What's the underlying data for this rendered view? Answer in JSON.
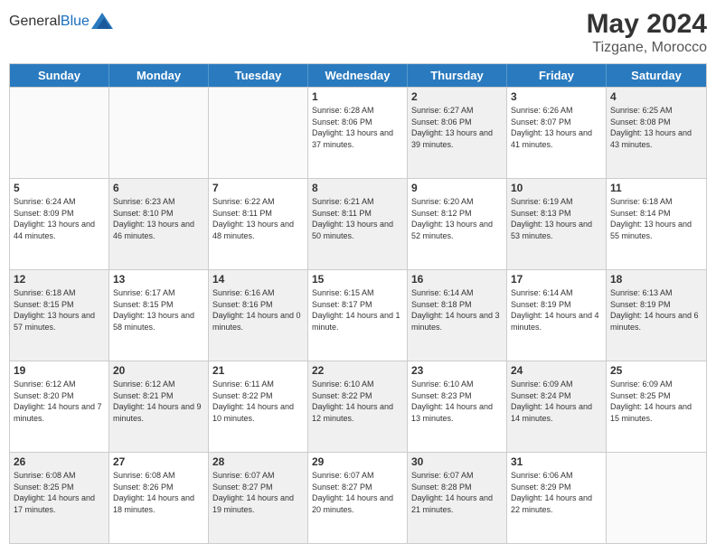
{
  "header": {
    "logo_general": "General",
    "logo_blue": "Blue",
    "month_year": "May 2024",
    "location": "Tizgane, Morocco"
  },
  "days_of_week": [
    "Sunday",
    "Monday",
    "Tuesday",
    "Wednesday",
    "Thursday",
    "Friday",
    "Saturday"
  ],
  "weeks": [
    [
      {
        "day": "",
        "info": "",
        "shaded": false,
        "empty": true
      },
      {
        "day": "",
        "info": "",
        "shaded": false,
        "empty": true
      },
      {
        "day": "",
        "info": "",
        "shaded": false,
        "empty": true
      },
      {
        "day": "1",
        "info": "Sunrise: 6:28 AM\nSunset: 8:06 PM\nDaylight: 13 hours and 37 minutes.",
        "shaded": false,
        "empty": false
      },
      {
        "day": "2",
        "info": "Sunrise: 6:27 AM\nSunset: 8:06 PM\nDaylight: 13 hours and 39 minutes.",
        "shaded": true,
        "empty": false
      },
      {
        "day": "3",
        "info": "Sunrise: 6:26 AM\nSunset: 8:07 PM\nDaylight: 13 hours and 41 minutes.",
        "shaded": false,
        "empty": false
      },
      {
        "day": "4",
        "info": "Sunrise: 6:25 AM\nSunset: 8:08 PM\nDaylight: 13 hours and 43 minutes.",
        "shaded": true,
        "empty": false
      }
    ],
    [
      {
        "day": "5",
        "info": "Sunrise: 6:24 AM\nSunset: 8:09 PM\nDaylight: 13 hours and 44 minutes.",
        "shaded": false,
        "empty": false
      },
      {
        "day": "6",
        "info": "Sunrise: 6:23 AM\nSunset: 8:10 PM\nDaylight: 13 hours and 46 minutes.",
        "shaded": true,
        "empty": false
      },
      {
        "day": "7",
        "info": "Sunrise: 6:22 AM\nSunset: 8:11 PM\nDaylight: 13 hours and 48 minutes.",
        "shaded": false,
        "empty": false
      },
      {
        "day": "8",
        "info": "Sunrise: 6:21 AM\nSunset: 8:11 PM\nDaylight: 13 hours and 50 minutes.",
        "shaded": true,
        "empty": false
      },
      {
        "day": "9",
        "info": "Sunrise: 6:20 AM\nSunset: 8:12 PM\nDaylight: 13 hours and 52 minutes.",
        "shaded": false,
        "empty": false
      },
      {
        "day": "10",
        "info": "Sunrise: 6:19 AM\nSunset: 8:13 PM\nDaylight: 13 hours and 53 minutes.",
        "shaded": true,
        "empty": false
      },
      {
        "day": "11",
        "info": "Sunrise: 6:18 AM\nSunset: 8:14 PM\nDaylight: 13 hours and 55 minutes.",
        "shaded": false,
        "empty": false
      }
    ],
    [
      {
        "day": "12",
        "info": "Sunrise: 6:18 AM\nSunset: 8:15 PM\nDaylight: 13 hours and 57 minutes.",
        "shaded": true,
        "empty": false
      },
      {
        "day": "13",
        "info": "Sunrise: 6:17 AM\nSunset: 8:15 PM\nDaylight: 13 hours and 58 minutes.",
        "shaded": false,
        "empty": false
      },
      {
        "day": "14",
        "info": "Sunrise: 6:16 AM\nSunset: 8:16 PM\nDaylight: 14 hours and 0 minutes.",
        "shaded": true,
        "empty": false
      },
      {
        "day": "15",
        "info": "Sunrise: 6:15 AM\nSunset: 8:17 PM\nDaylight: 14 hours and 1 minute.",
        "shaded": false,
        "empty": false
      },
      {
        "day": "16",
        "info": "Sunrise: 6:14 AM\nSunset: 8:18 PM\nDaylight: 14 hours and 3 minutes.",
        "shaded": true,
        "empty": false
      },
      {
        "day": "17",
        "info": "Sunrise: 6:14 AM\nSunset: 8:19 PM\nDaylight: 14 hours and 4 minutes.",
        "shaded": false,
        "empty": false
      },
      {
        "day": "18",
        "info": "Sunrise: 6:13 AM\nSunset: 8:19 PM\nDaylight: 14 hours and 6 minutes.",
        "shaded": true,
        "empty": false
      }
    ],
    [
      {
        "day": "19",
        "info": "Sunrise: 6:12 AM\nSunset: 8:20 PM\nDaylight: 14 hours and 7 minutes.",
        "shaded": false,
        "empty": false
      },
      {
        "day": "20",
        "info": "Sunrise: 6:12 AM\nSunset: 8:21 PM\nDaylight: 14 hours and 9 minutes.",
        "shaded": true,
        "empty": false
      },
      {
        "day": "21",
        "info": "Sunrise: 6:11 AM\nSunset: 8:22 PM\nDaylight: 14 hours and 10 minutes.",
        "shaded": false,
        "empty": false
      },
      {
        "day": "22",
        "info": "Sunrise: 6:10 AM\nSunset: 8:22 PM\nDaylight: 14 hours and 12 minutes.",
        "shaded": true,
        "empty": false
      },
      {
        "day": "23",
        "info": "Sunrise: 6:10 AM\nSunset: 8:23 PM\nDaylight: 14 hours and 13 minutes.",
        "shaded": false,
        "empty": false
      },
      {
        "day": "24",
        "info": "Sunrise: 6:09 AM\nSunset: 8:24 PM\nDaylight: 14 hours and 14 minutes.",
        "shaded": true,
        "empty": false
      },
      {
        "day": "25",
        "info": "Sunrise: 6:09 AM\nSunset: 8:25 PM\nDaylight: 14 hours and 15 minutes.",
        "shaded": false,
        "empty": false
      }
    ],
    [
      {
        "day": "26",
        "info": "Sunrise: 6:08 AM\nSunset: 8:25 PM\nDaylight: 14 hours and 17 minutes.",
        "shaded": true,
        "empty": false
      },
      {
        "day": "27",
        "info": "Sunrise: 6:08 AM\nSunset: 8:26 PM\nDaylight: 14 hours and 18 minutes.",
        "shaded": false,
        "empty": false
      },
      {
        "day": "28",
        "info": "Sunrise: 6:07 AM\nSunset: 8:27 PM\nDaylight: 14 hours and 19 minutes.",
        "shaded": true,
        "empty": false
      },
      {
        "day": "29",
        "info": "Sunrise: 6:07 AM\nSunset: 8:27 PM\nDaylight: 14 hours and 20 minutes.",
        "shaded": false,
        "empty": false
      },
      {
        "day": "30",
        "info": "Sunrise: 6:07 AM\nSunset: 8:28 PM\nDaylight: 14 hours and 21 minutes.",
        "shaded": true,
        "empty": false
      },
      {
        "day": "31",
        "info": "Sunrise: 6:06 AM\nSunset: 8:29 PM\nDaylight: 14 hours and 22 minutes.",
        "shaded": false,
        "empty": false
      },
      {
        "day": "",
        "info": "",
        "shaded": false,
        "empty": true
      }
    ]
  ]
}
